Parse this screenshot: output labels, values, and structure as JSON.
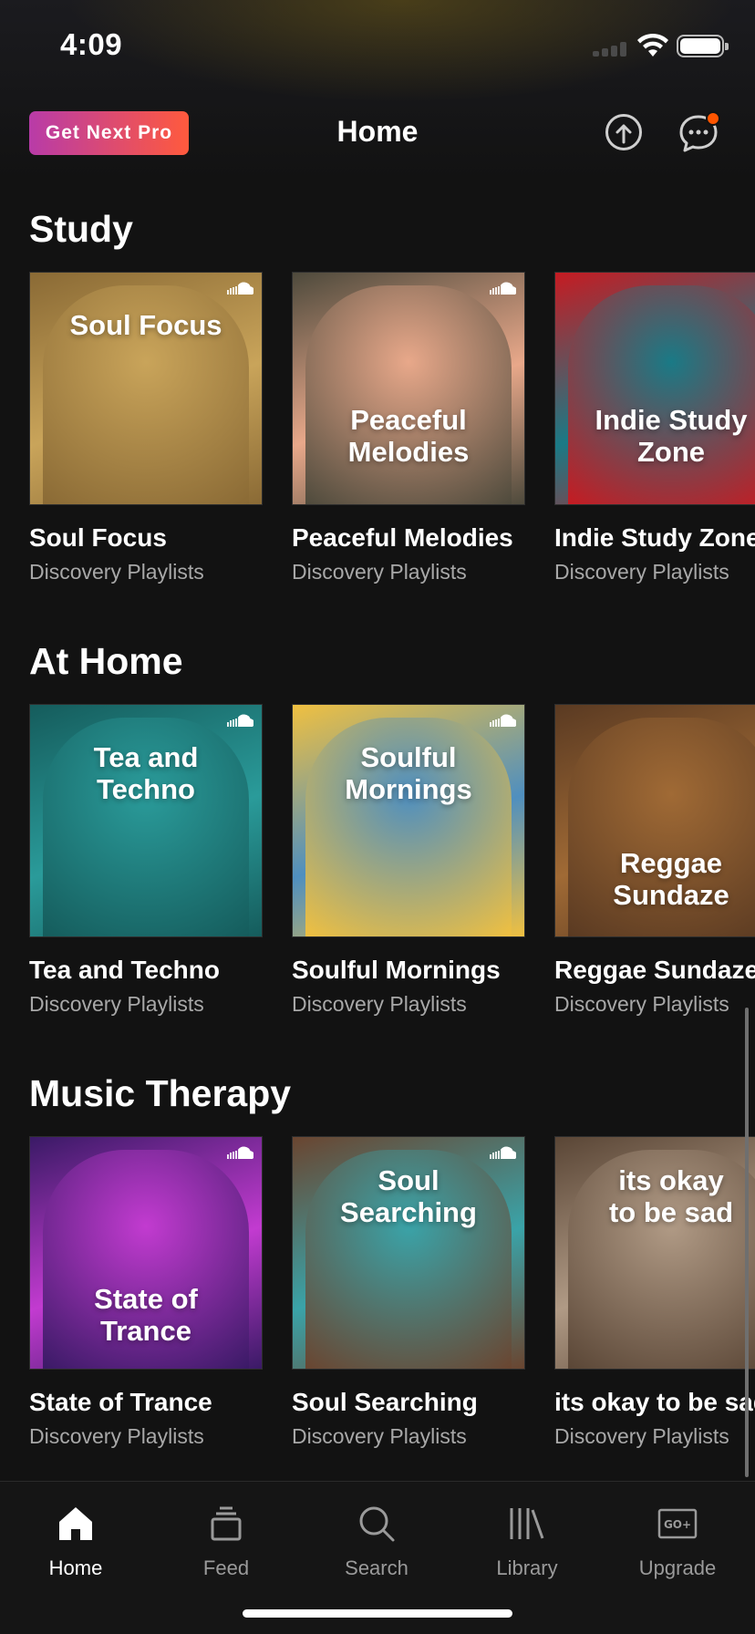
{
  "status_bar": {
    "time": "4:09"
  },
  "header": {
    "pro_label": "Get Next Pro",
    "title": "Home",
    "upload_icon": "upload-icon",
    "messages_icon": "messages-icon",
    "notification_color": "#ff5500"
  },
  "sections": [
    {
      "title": "Study",
      "items": [
        {
          "art_text": "Soul Focus",
          "title": "Soul Focus",
          "subtitle": "Discovery Playlists",
          "colors": [
            "#c9a45a",
            "#8a6a35"
          ]
        },
        {
          "art_text": "Peaceful Melodies",
          "title": "Peaceful Melodies",
          "subtitle": "Discovery Playlists",
          "colors": [
            "#e8a88a",
            "#4e4a3c"
          ]
        },
        {
          "art_text": "Indie Study Zone",
          "title": "Indie Study Zone",
          "subtitle": "Discovery Playlists",
          "colors": [
            "#1a7a86",
            "#c61b22"
          ]
        }
      ]
    },
    {
      "title": "At Home",
      "items": [
        {
          "art_text": "Tea and Techno",
          "title": "Tea and Techno",
          "subtitle": "Discovery Playlists",
          "colors": [
            "#2a9b9a",
            "#155c5c"
          ]
        },
        {
          "art_text": "Soulful Mornings",
          "title": "Soulful Mornings",
          "subtitle": "Discovery Playlists",
          "colors": [
            "#4f8fbf",
            "#f0c040"
          ]
        },
        {
          "art_text": "Reggae Sundaze",
          "title": "Reggae Sundaze",
          "subtitle": "Discovery Playlists",
          "colors": [
            "#a06a35",
            "#5a3a22"
          ]
        }
      ]
    },
    {
      "title": "Music Therapy",
      "items": [
        {
          "art_text": "State of Trance",
          "title": "State of Trance",
          "subtitle": "Discovery Playlists",
          "colors": [
            "#c23bd0",
            "#3a1a66"
          ]
        },
        {
          "art_text": "Soul Searching",
          "title": "Soul Searching",
          "subtitle": "Discovery Playlists",
          "colors": [
            "#3aa3a8",
            "#6a4530"
          ]
        },
        {
          "art_text": "its okay to be sad",
          "title": "its okay to be sad",
          "subtitle": "Discovery Playlists",
          "colors": [
            "#b09a85",
            "#5a4636"
          ]
        }
      ]
    }
  ],
  "tab_bar": [
    {
      "label": "Home",
      "icon": "home-icon",
      "active": true
    },
    {
      "label": "Feed",
      "icon": "feed-icon",
      "active": false
    },
    {
      "label": "Search",
      "icon": "search-icon",
      "active": false
    },
    {
      "label": "Library",
      "icon": "library-icon",
      "active": false
    },
    {
      "label": "Upgrade",
      "icon": "upgrade-icon",
      "active": false
    }
  ]
}
